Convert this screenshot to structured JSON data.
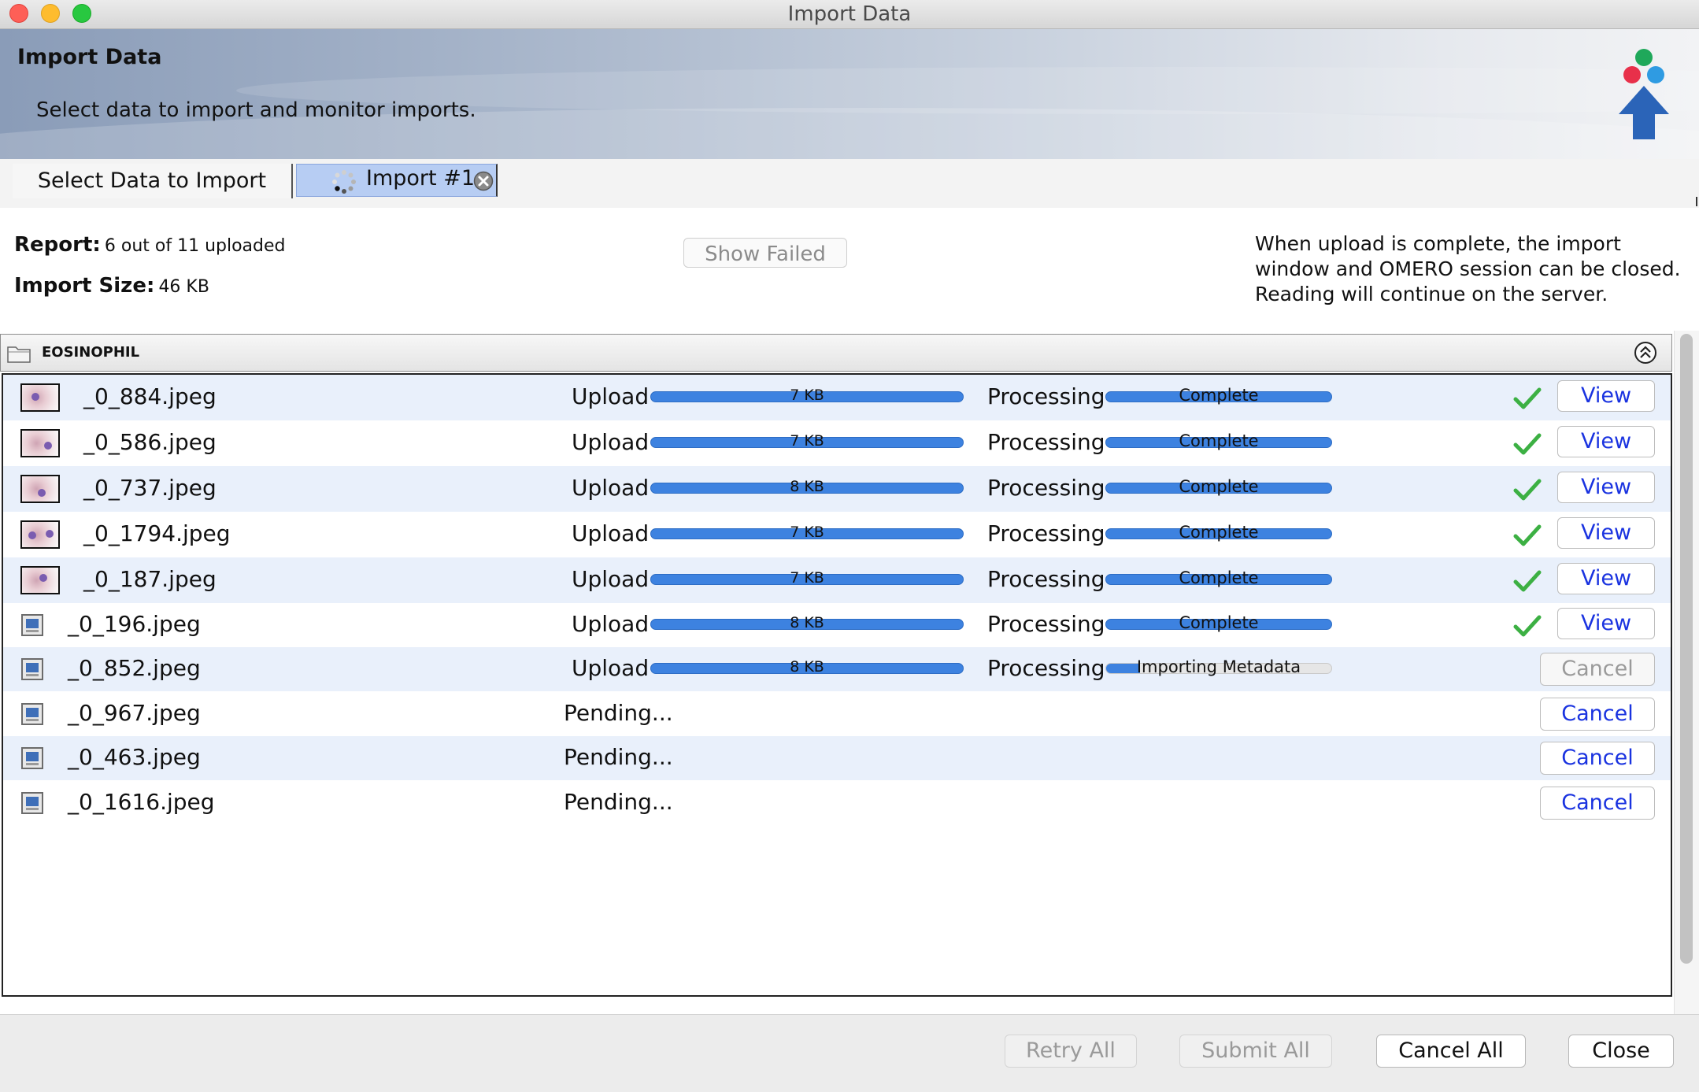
{
  "window": {
    "title": "Import Data"
  },
  "banner": {
    "title": "Import Data",
    "subtitle": "Select data to import and monitor imports.",
    "logo_icon": "omero-import-logo-icon"
  },
  "tabs": [
    {
      "label": "Select Data to Import",
      "selected": false
    },
    {
      "label": "Import #1",
      "selected": true,
      "icons": [
        "spinner-icon",
        "close-icon"
      ]
    }
  ],
  "report": {
    "report_label": "Report:",
    "report_value": "6 out of 11 uploaded",
    "size_label": "Import Size:",
    "size_value": "46 KB",
    "show_failed_label": "Show Failed",
    "note_lines": [
      "When upload is complete, the import",
      "window and OMERO session can be closed.",
      "Reading will continue on the server."
    ]
  },
  "group": {
    "name": "EOSINOPHIL",
    "icon": "folder-icon",
    "collapse_icon": "collapse-up-icon"
  },
  "labels": {
    "upload": "Upload",
    "processing": "Processing",
    "pending": "Pending...",
    "view": "View",
    "cancel": "Cancel"
  },
  "files": [
    {
      "name": "_0_884.jpeg",
      "thumb": true,
      "state": "done",
      "upload_text": "7 KB",
      "processing_text": "Complete",
      "processing_fraction": 1.0
    },
    {
      "name": "_0_586.jpeg",
      "thumb": true,
      "state": "done",
      "upload_text": "7 KB",
      "processing_text": "Complete",
      "processing_fraction": 1.0
    },
    {
      "name": "_0_737.jpeg",
      "thumb": true,
      "state": "done",
      "upload_text": "8 KB",
      "processing_text": "Complete",
      "processing_fraction": 1.0
    },
    {
      "name": "_0_1794.jpeg",
      "thumb": true,
      "state": "done",
      "upload_text": "7 KB",
      "processing_text": "Complete",
      "processing_fraction": 1.0
    },
    {
      "name": "_0_187.jpeg",
      "thumb": true,
      "state": "done",
      "upload_text": "7 KB",
      "processing_text": "Complete",
      "processing_fraction": 1.0
    },
    {
      "name": "_0_196.jpeg",
      "thumb": false,
      "state": "done",
      "upload_text": "8 KB",
      "processing_text": "Complete",
      "processing_fraction": 1.0
    },
    {
      "name": "_0_852.jpeg",
      "thumb": false,
      "state": "processing",
      "upload_text": "8 KB",
      "processing_text": "Importing Metadata",
      "processing_fraction": 0.15
    },
    {
      "name": "_0_967.jpeg",
      "thumb": false,
      "state": "pending"
    },
    {
      "name": "_0_463.jpeg",
      "thumb": false,
      "state": "pending"
    },
    {
      "name": "_0_1616.jpeg",
      "thumb": false,
      "state": "pending"
    }
  ],
  "footer": {
    "retry_all": "Retry All",
    "submit_all": "Submit All",
    "cancel_all": "Cancel All",
    "close": "Close"
  },
  "colors": {
    "progress": "#3d82e0",
    "link_blue": "#1a33e0",
    "check_green": "#3cb043",
    "selected_tab": "#b7cdf3",
    "row_alt": "#e9f0fb"
  }
}
